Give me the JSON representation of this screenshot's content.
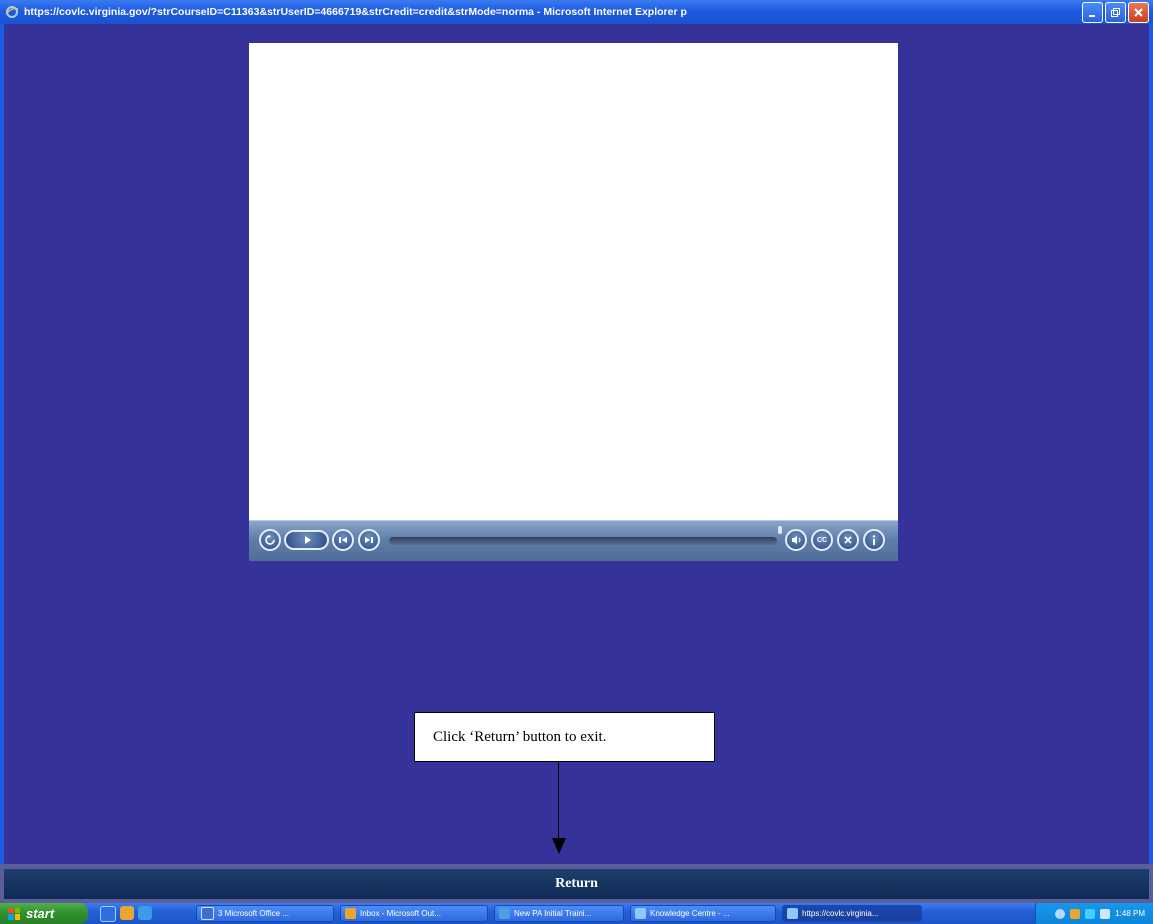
{
  "window": {
    "title": "https://covlc.virginia.gov/?strCourseID=C11363&strUserID=4666719&strCredit=credit&strMode=norma - Microsoft Internet Explorer p",
    "buttons": [
      "minimize",
      "maximize",
      "close"
    ]
  },
  "player": {
    "controls": [
      "replay-icon",
      "play-icon",
      "previous-icon",
      "next-icon",
      "volume-icon",
      "closed-caption-icon",
      "exit-icon",
      "info-icon"
    ],
    "cc_label": "CC"
  },
  "callout": {
    "text": "Click ‘Return’ button to exit."
  },
  "return_bar": {
    "label": "Return"
  },
  "taskbar": {
    "start_label": "start",
    "tasks": [
      {
        "label": "3 Microsoft Office ...",
        "active": false
      },
      {
        "label": "Inbox - Microsoft Out...",
        "active": false
      },
      {
        "label": "New PA Initial Traini...",
        "active": false
      },
      {
        "label": "Knowledge Centre - ...",
        "active": false
      },
      {
        "label": "https://covlc.virginia...",
        "active": true
      }
    ],
    "clock": "1:48 PM"
  },
  "colors": {
    "background": "#35339a",
    "return_bar": "#0f2a54",
    "taskbar": "#2460d8",
    "start": "#2f8f2b"
  }
}
